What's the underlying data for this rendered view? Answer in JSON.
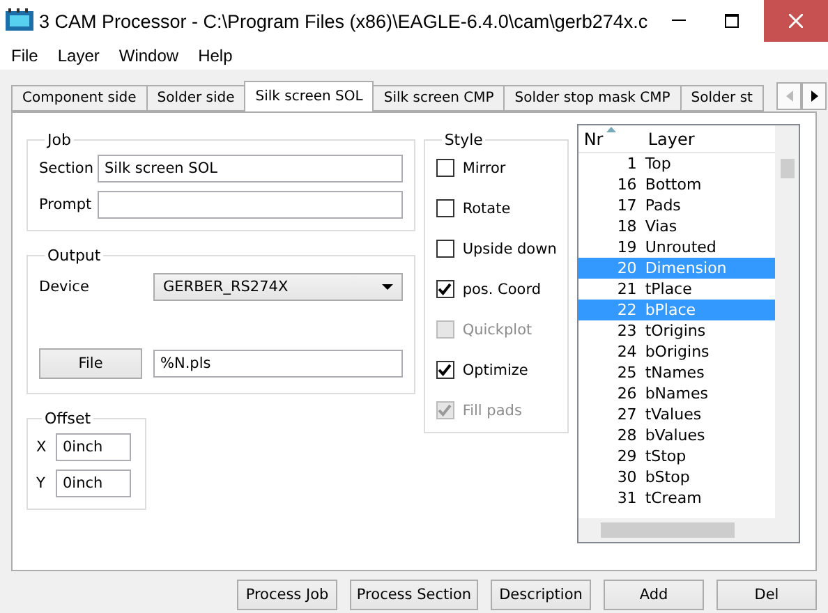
{
  "window": {
    "title": "3 CAM Processor - C:\\Program Files (x86)\\EAGLE-6.4.0\\cam\\gerb274x.c"
  },
  "menu": [
    "File",
    "Layer",
    "Window",
    "Help"
  ],
  "tabs": [
    {
      "label": "Component side",
      "selected": false
    },
    {
      "label": "Solder side",
      "selected": false
    },
    {
      "label": "Silk screen SOL",
      "selected": true
    },
    {
      "label": "Silk screen CMP",
      "selected": false
    },
    {
      "label": "Solder stop mask CMP",
      "selected": false
    },
    {
      "label": "Solder st",
      "selected": false
    }
  ],
  "job": {
    "title": "Job",
    "section_label": "Section",
    "section_value": "Silk screen SOL",
    "prompt_label": "Prompt"
  },
  "output": {
    "title": "Output",
    "device_label": "Device",
    "device_value": "GERBER_RS274X",
    "file_button": "File",
    "file_value": "%N.pls"
  },
  "offset": {
    "title": "Offset",
    "x_label": "X",
    "x_value": "0inch",
    "y_label": "Y",
    "y_value": "0inch"
  },
  "style": {
    "title": "Style",
    "options": [
      {
        "label": "Mirror",
        "checked": false,
        "disabled": false
      },
      {
        "label": "Rotate",
        "checked": false,
        "disabled": false
      },
      {
        "label": "Upside down",
        "checked": false,
        "disabled": false
      },
      {
        "label": "pos. Coord",
        "checked": true,
        "disabled": false
      },
      {
        "label": "Quickplot",
        "checked": false,
        "disabled": true
      },
      {
        "label": "Optimize",
        "checked": true,
        "disabled": false
      },
      {
        "label": "Fill pads",
        "checked": true,
        "disabled": true
      }
    ]
  },
  "layers": {
    "columns": [
      "Nr",
      "Layer"
    ],
    "rows": [
      {
        "nr": "1",
        "name": "Top",
        "selected": false
      },
      {
        "nr": "16",
        "name": "Bottom",
        "selected": false
      },
      {
        "nr": "17",
        "name": "Pads",
        "selected": false
      },
      {
        "nr": "18",
        "name": "Vias",
        "selected": false
      },
      {
        "nr": "19",
        "name": "Unrouted",
        "selected": false
      },
      {
        "nr": "20",
        "name": "Dimension",
        "selected": true
      },
      {
        "nr": "21",
        "name": "tPlace",
        "selected": false
      },
      {
        "nr": "22",
        "name": "bPlace",
        "selected": true
      },
      {
        "nr": "23",
        "name": "tOrigins",
        "selected": false
      },
      {
        "nr": "24",
        "name": "bOrigins",
        "selected": false
      },
      {
        "nr": "25",
        "name": "tNames",
        "selected": false
      },
      {
        "nr": "26",
        "name": "bNames",
        "selected": false
      },
      {
        "nr": "27",
        "name": "tValues",
        "selected": false
      },
      {
        "nr": "28",
        "name": "bValues",
        "selected": false
      },
      {
        "nr": "29",
        "name": "tStop",
        "selected": false
      },
      {
        "nr": "30",
        "name": "bStop",
        "selected": false
      },
      {
        "nr": "31",
        "name": "tCream",
        "selected": false
      }
    ]
  },
  "buttons": [
    "Process Job",
    "Process Section",
    "Description",
    "Add",
    "Del"
  ]
}
